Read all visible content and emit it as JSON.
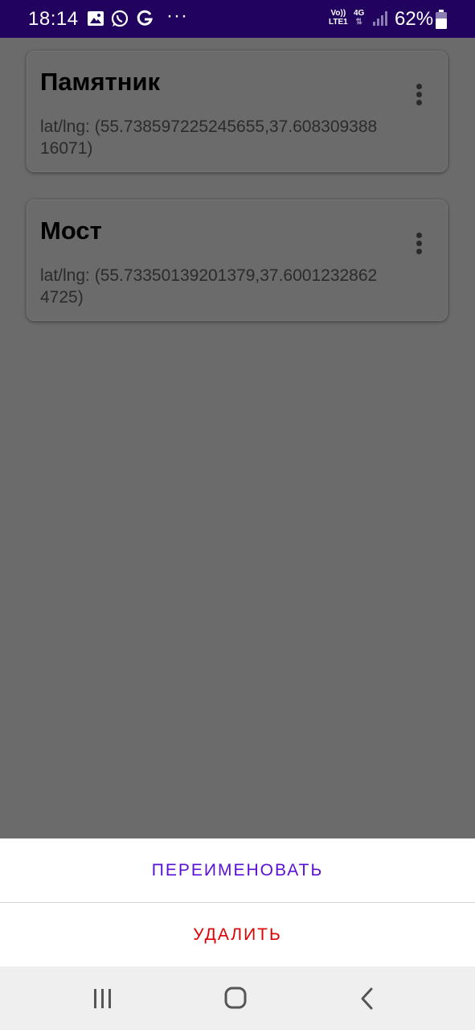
{
  "status_bar": {
    "time": "18:14",
    "more": "···",
    "net_line1": "Vo))",
    "net_line2": "LTE1",
    "net_type": "4G",
    "battery_percent": "62%",
    "icons": [
      "gallery-icon",
      "whatsapp-icon",
      "google-icon",
      "signal-icon",
      "battery-icon"
    ]
  },
  "places": [
    {
      "title": "Памятник",
      "coords": "lat/lng: (55.738597225245655,37.60830938816071)"
    },
    {
      "title": "Мост",
      "coords": "lat/lng: (55.73350139201379,37.60012328624725)"
    }
  ],
  "sheet": {
    "rename_label": "ПЕРЕИМЕНОВАТЬ",
    "delete_label": "УДАЛИТЬ",
    "rename_color": "#5a10d6",
    "delete_color": "#e00000"
  },
  "nav_bar": {
    "icons": [
      "recents-icon",
      "home-icon",
      "back-icon"
    ]
  },
  "colors": {
    "status_bar": "#22025f",
    "scrim": "#6b6b6b"
  }
}
